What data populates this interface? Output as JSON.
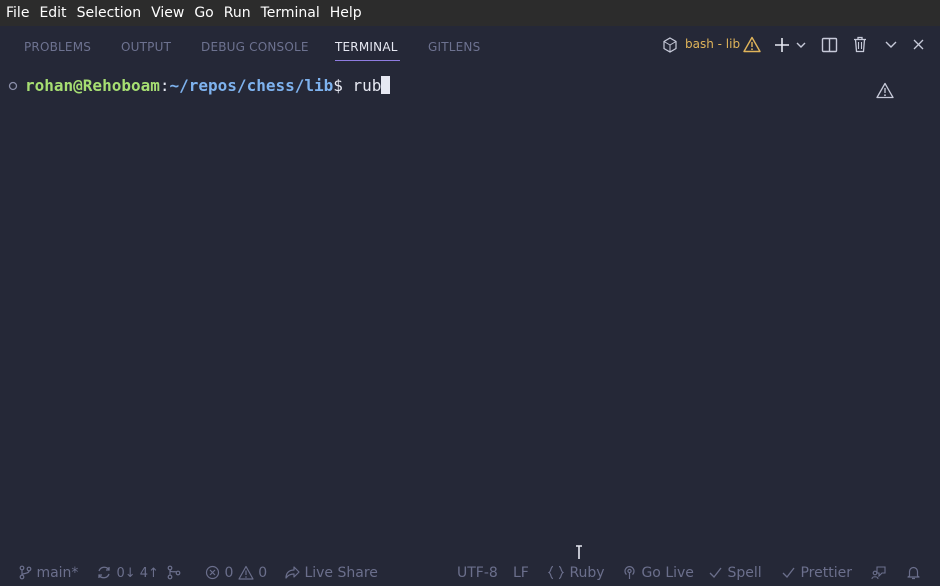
{
  "menu": [
    "File",
    "Edit",
    "Selection",
    "View",
    "Go",
    "Run",
    "Terminal",
    "Help"
  ],
  "panel": {
    "tabs": [
      "PROBLEMS",
      "OUTPUT",
      "DEBUG CONSOLE",
      "TERMINAL",
      "GITLENS"
    ],
    "active_tab": "TERMINAL",
    "terminal_name": "bash - lib"
  },
  "terminal": {
    "user_host": "rohan@Rehoboam",
    "separator": ":",
    "path": "~/repos/chess/lib",
    "dollar": "$ ",
    "typed": "rub"
  },
  "status": {
    "branch": "main*",
    "sync": "0↓ 4↑",
    "errors": "0",
    "warnings": "0",
    "live_share": "Live Share",
    "encoding": "UTF-8",
    "eol": "LF",
    "language": "Ruby",
    "go_live": "Go Live",
    "spell": "Spell",
    "prettier": "Prettier"
  },
  "colors": {
    "background": "#252837",
    "menubar": "#2c2c2c",
    "prompt_user": "#a6de72",
    "prompt_path": "#7eb2ee",
    "active_tab_underline": "#8f7ce0",
    "terminal_name": "#e0b45a"
  }
}
